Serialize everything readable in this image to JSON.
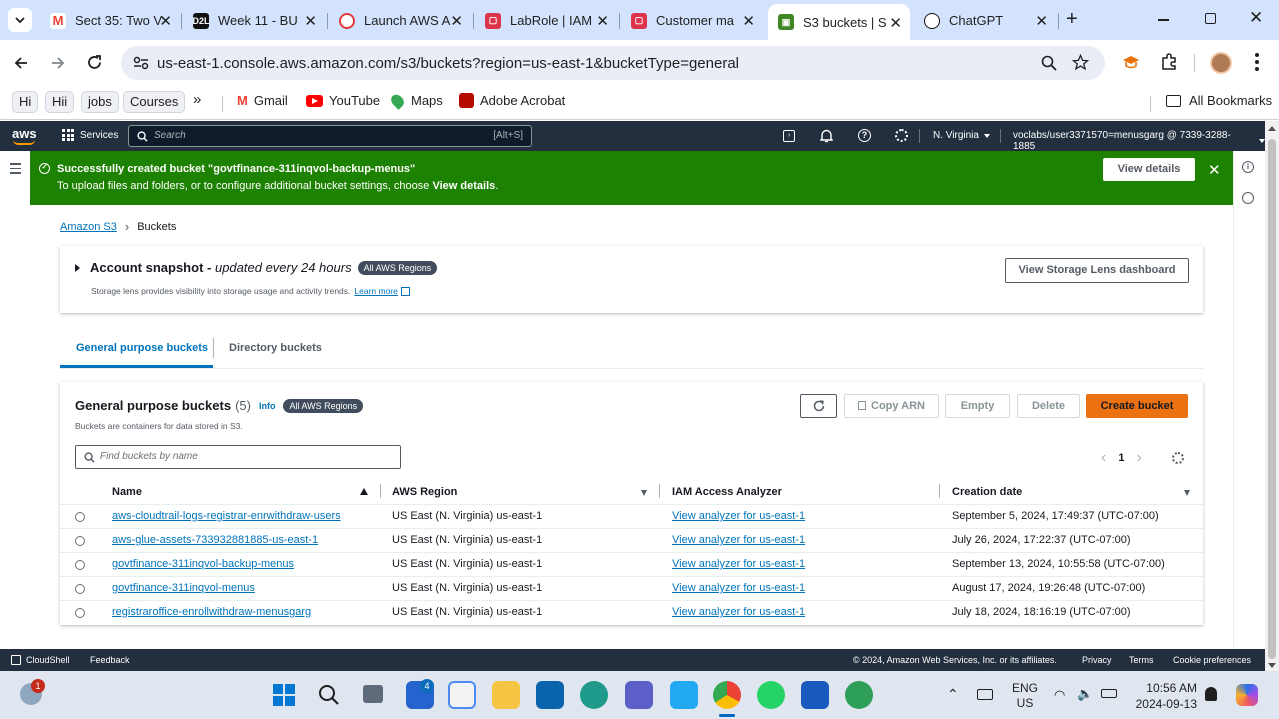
{
  "browser": {
    "tabs": [
      {
        "title": "Sect 35: Two V",
        "icon": "gmail-icon",
        "color": "#ea4335"
      },
      {
        "title": "Week 11 - BU",
        "icon": "d2l-icon",
        "color": "#111111"
      },
      {
        "title": "Launch AWS A",
        "icon": "aws-academy-icon",
        "color": "#e03b3b"
      },
      {
        "title": "LabRole | IAM",
        "icon": "aws-red-icon",
        "color": "#dd344c"
      },
      {
        "title": "Customer ma",
        "icon": "aws-red-icon",
        "color": "#dd344c"
      },
      {
        "title": "S3 buckets | S",
        "icon": "s3-icon",
        "color": "#3f8624",
        "active": true
      },
      {
        "title": "ChatGPT",
        "icon": "chatgpt-icon",
        "color": "#111111"
      }
    ],
    "url": "us-east-1.console.aws.amazon.com/s3/buckets?region=us-east-1&bucketType=general",
    "bookmarks": {
      "chips": [
        "Hi",
        "Hii",
        "jobs",
        "Courses"
      ],
      "more": "»",
      "items": [
        "Gmail",
        "YouTube",
        "Maps",
        "Adobe Acrobat"
      ],
      "all": "All Bookmarks"
    }
  },
  "aws_nav": {
    "logo": "aws",
    "services": "Services",
    "search_placeholder": "Search",
    "search_shortcut": "[Alt+S]",
    "region": "N. Virginia",
    "account": "voclabs/user3371570=menusgarg @ 7339-3288-1885"
  },
  "flash": {
    "title": "Successfully created bucket \"govtfinance-311inqvol-backup-menus\"",
    "message_prefix": "To upload files and folders, or to configure additional bucket settings, choose ",
    "message_bold": "View details",
    "message_suffix": ".",
    "button": "View details",
    "color": "#1d8102"
  },
  "breadcrumb": {
    "root": "Amazon S3",
    "current": "Buckets"
  },
  "snapshot": {
    "title": "Account snapshot",
    "dash": " - ",
    "subtitle": "updated every 24 hours",
    "badge": "All AWS Regions",
    "description": "Storage lens provides visibility into storage usage and activity trends.",
    "learn_more": "Learn more",
    "button": "View Storage Lens dashboard"
  },
  "tabs": {
    "general": "General purpose buckets",
    "directory": "Directory buckets"
  },
  "buckets": {
    "title": "General purpose buckets",
    "count": "(5)",
    "info": "Info",
    "badge": "All AWS Regions",
    "description": "Buckets are containers for data stored in S3.",
    "search_placeholder": "Find buckets by name",
    "buttons": {
      "copy_arn": "Copy ARN",
      "empty": "Empty",
      "delete": "Delete",
      "create": "Create bucket"
    },
    "page": "1",
    "columns": [
      "Name",
      "AWS Region",
      "IAM Access Analyzer",
      "Creation date"
    ],
    "rows": [
      {
        "name": "aws-cloudtrail-logs-registrar-enrwithdraw-users",
        "region": "US East (N. Virginia) us-east-1",
        "analyzer": "View analyzer for us-east-1",
        "date": "September 5, 2024, 17:49:37 (UTC-07:00)"
      },
      {
        "name": "aws-glue-assets-733932881885-us-east-1",
        "region": "US East (N. Virginia) us-east-1",
        "analyzer": "View analyzer for us-east-1",
        "date": "July 26, 2024, 17:22:37 (UTC-07:00)"
      },
      {
        "name": "govtfinance-311inqvol-backup-menus",
        "region": "US East (N. Virginia) us-east-1",
        "analyzer": "View analyzer for us-east-1",
        "date": "September 13, 2024, 10:55:58 (UTC-07:00)"
      },
      {
        "name": "govtfinance-311inqvol-menus",
        "region": "US East (N. Virginia) us-east-1",
        "analyzer": "View analyzer for us-east-1",
        "date": "August 17, 2024, 19:26:48 (UTC-07:00)"
      },
      {
        "name": "registraroffice-enrollwithdraw-menusgarg",
        "region": "US East (N. Virginia) us-east-1",
        "analyzer": "View analyzer for us-east-1",
        "date": "July 18, 2024, 18:16:19 (UTC-07:00)"
      }
    ]
  },
  "footer": {
    "cloudshell": "CloudShell",
    "feedback": "Feedback",
    "copyright": "© 2024, Amazon Web Services, Inc. or its affiliates.",
    "links": [
      "Privacy",
      "Terms",
      "Cookie preferences"
    ]
  },
  "taskbar": {
    "weather_badge": "1",
    "outlook_badge": "4",
    "lang_1": "ENG",
    "lang_2": "US",
    "time": "10:56 AM",
    "date": "2024-09-13"
  },
  "colors": {
    "accent": "#ec7211",
    "link": "#0073bb",
    "nav": "#232f3e",
    "success": "#1d8102"
  }
}
